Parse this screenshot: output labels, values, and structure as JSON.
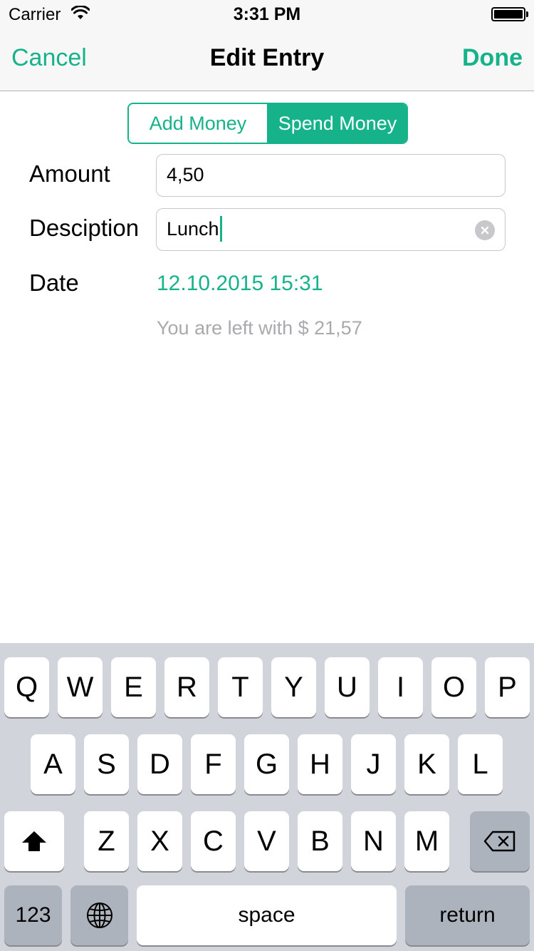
{
  "status_bar": {
    "carrier": "Carrier",
    "time": "3:31 PM"
  },
  "nav": {
    "cancel_label": "Cancel",
    "title": "Edit Entry",
    "done_label": "Done"
  },
  "segments": {
    "add_label": "Add Money",
    "spend_label": "Spend Money",
    "selected": "Spend Money"
  },
  "form": {
    "amount_label": "Amount",
    "amount_value": "4,50",
    "description_label": "Desciption",
    "description_value": "Lunch",
    "date_label": "Date",
    "date_value": "12.10.2015 15:31",
    "balance_text": "You are left with $ 21,57"
  },
  "keyboard": {
    "row1": [
      "Q",
      "W",
      "E",
      "R",
      "T",
      "Y",
      "U",
      "I",
      "O",
      "P"
    ],
    "row2": [
      "A",
      "S",
      "D",
      "F",
      "G",
      "H",
      "J",
      "K",
      "L"
    ],
    "row3": [
      "Z",
      "X",
      "C",
      "V",
      "B",
      "N",
      "M"
    ],
    "numbers_label": "123",
    "space_label": "space",
    "return_label": "return",
    "shift_icon": "shift-icon",
    "delete_icon": "delete-icon",
    "globe_icon": "globe-icon"
  },
  "colors": {
    "accent": "#16b28a",
    "placeholder_gray": "#a9a9ae",
    "keyboard_bg": "#d1d5db"
  }
}
